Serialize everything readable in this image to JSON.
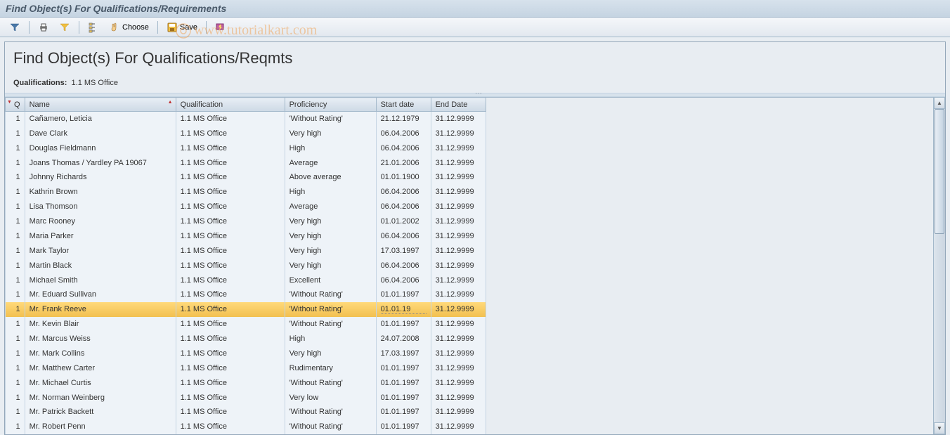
{
  "window": {
    "title": "Find Object(s) For Qualifications/Requirements"
  },
  "toolbar": {
    "choose_label": "Choose",
    "save_label": "Save"
  },
  "report": {
    "title": "Find Object(s) For Qualifications/Reqmts",
    "sub_label": "Qualifications:",
    "sub_value": "1.1 MS Office"
  },
  "columns": {
    "q": "Q",
    "name": "Name",
    "qualification": "Qualification",
    "proficiency": "Proficiency",
    "start": "Start date",
    "end": "End Date"
  },
  "rows": [
    {
      "q": "1",
      "name": "Cañamero, Leticia",
      "qual": "1.1 MS Office",
      "prof": "'Without Rating'",
      "start": "21.12.1979",
      "end": "31.12.9999",
      "sel": false
    },
    {
      "q": "1",
      "name": "Dave Clark",
      "qual": "1.1 MS Office",
      "prof": "Very high",
      "start": "06.04.2006",
      "end": "31.12.9999",
      "sel": false
    },
    {
      "q": "1",
      "name": "Douglas Fieldmann",
      "qual": "1.1 MS Office",
      "prof": "High",
      "start": "06.04.2006",
      "end": "31.12.9999",
      "sel": false
    },
    {
      "q": "1",
      "name": "Joans Thomas / Yardley PA 19067",
      "qual": "1.1 MS Office",
      "prof": "Average",
      "start": "21.01.2006",
      "end": "31.12.9999",
      "sel": false
    },
    {
      "q": "1",
      "name": "Johnny Richards",
      "qual": "1.1 MS Office",
      "prof": "Above average",
      "start": "01.01.1900",
      "end": "31.12.9999",
      "sel": false
    },
    {
      "q": "1",
      "name": "Kathrin Brown",
      "qual": "1.1 MS Office",
      "prof": "High",
      "start": "06.04.2006",
      "end": "31.12.9999",
      "sel": false
    },
    {
      "q": "1",
      "name": "Lisa Thomson",
      "qual": "1.1 MS Office",
      "prof": "Average",
      "start": "06.04.2006",
      "end": "31.12.9999",
      "sel": false
    },
    {
      "q": "1",
      "name": "Marc Rooney",
      "qual": "1.1 MS Office",
      "prof": "Very high",
      "start": "01.01.2002",
      "end": "31.12.9999",
      "sel": false
    },
    {
      "q": "1",
      "name": "Maria Parker",
      "qual": "1.1 MS Office",
      "prof": "Very high",
      "start": "06.04.2006",
      "end": "31.12.9999",
      "sel": false
    },
    {
      "q": "1",
      "name": "Mark Taylor",
      "qual": "1.1 MS Office",
      "prof": "Very high",
      "start": "17.03.1997",
      "end": "31.12.9999",
      "sel": false
    },
    {
      "q": "1",
      "name": "Martin Black",
      "qual": "1.1 MS Office",
      "prof": "Very high",
      "start": "06.04.2006",
      "end": "31.12.9999",
      "sel": false
    },
    {
      "q": "1",
      "name": "Michael Smith",
      "qual": "1.1 MS Office",
      "prof": "Excellent",
      "start": "06.04.2006",
      "end": "31.12.9999",
      "sel": false
    },
    {
      "q": "1",
      "name": "Mr. Eduard Sullivan",
      "qual": "1.1 MS Office",
      "prof": "'Without Rating'",
      "start": "01.01.1997",
      "end": "31.12.9999",
      "sel": false
    },
    {
      "q": "1",
      "name": "Mr. Frank Reeve",
      "qual": "1.1 MS Office",
      "prof": "'Without Rating'",
      "start": "01.01.19",
      "end": "31.12.9999",
      "sel": true
    },
    {
      "q": "1",
      "name": "Mr. Kevin Blair",
      "qual": "1.1 MS Office",
      "prof": "'Without Rating'",
      "start": "01.01.1997",
      "end": "31.12.9999",
      "sel": false
    },
    {
      "q": "1",
      "name": "Mr. Marcus Weiss",
      "qual": "1.1 MS Office",
      "prof": "High",
      "start": "24.07.2008",
      "end": "31.12.9999",
      "sel": false
    },
    {
      "q": "1",
      "name": "Mr. Mark Collins",
      "qual": "1.1 MS Office",
      "prof": "Very high",
      "start": "17.03.1997",
      "end": "31.12.9999",
      "sel": false
    },
    {
      "q": "1",
      "name": "Mr. Matthew Carter",
      "qual": "1.1 MS Office",
      "prof": "Rudimentary",
      "start": "01.01.1997",
      "end": "31.12.9999",
      "sel": false
    },
    {
      "q": "1",
      "name": "Mr. Michael Curtis",
      "qual": "1.1 MS Office",
      "prof": "'Without Rating'",
      "start": "01.01.1997",
      "end": "31.12.9999",
      "sel": false
    },
    {
      "q": "1",
      "name": "Mr. Norman Weinberg",
      "qual": "1.1 MS Office",
      "prof": "Very low",
      "start": "01.01.1997",
      "end": "31.12.9999",
      "sel": false
    },
    {
      "q": "1",
      "name": "Mr. Patrick Backett",
      "qual": "1.1 MS Office",
      "prof": "'Without Rating'",
      "start": "01.01.1997",
      "end": "31.12.9999",
      "sel": false
    },
    {
      "q": "1",
      "name": "Mr. Robert Penn",
      "qual": "1.1 MS Office",
      "prof": "'Without Rating'",
      "start": "01.01.1997",
      "end": "31.12.9999",
      "sel": false
    }
  ],
  "watermark": "www.tutorialkart.com"
}
